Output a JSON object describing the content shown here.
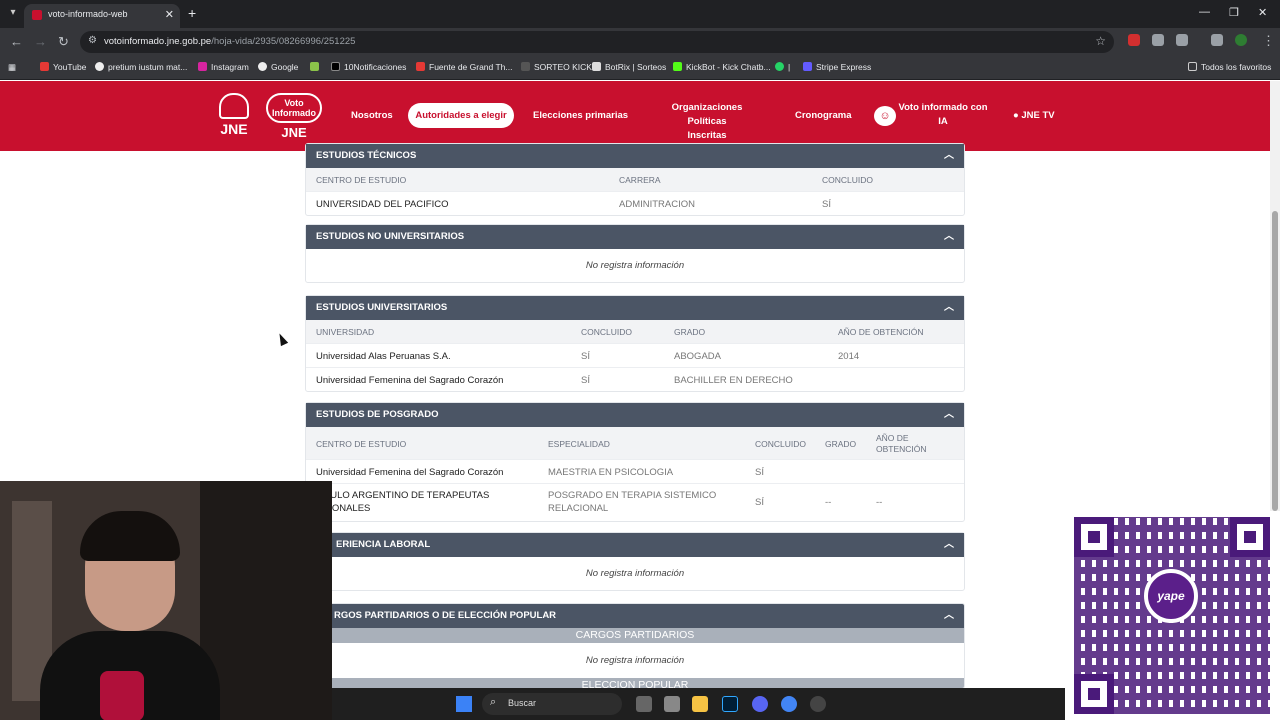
{
  "browser": {
    "tab_title": "voto-informado-web",
    "tab_close": "✕",
    "new_tab": "+",
    "url_host": "votoinformado.jne.gob.pe",
    "url_path": "/hoja-vida/2935/08266996/251225",
    "bookmarks": [
      "YouTube",
      "pretium iustum mat...",
      "Instagram",
      "Google",
      "",
      "10Notificaciones",
      "Fuente de Grand Th...",
      "SORTEO KICK",
      "BotRix | Sorteos",
      "KickBot - Kick Chatb...",
      "|",
      "Stripe Express"
    ],
    "all_bookmarks": "Todos los favoritos"
  },
  "header": {
    "logo_jne": "JNE",
    "logo_voto": "Voto Informado",
    "logo_voto_sub": "JNE",
    "nav": {
      "nosotros": "Nosotros",
      "autoridades": "Autoridades a elegir",
      "elecciones": "Elecciones primarias",
      "organizaciones_1": "Organizaciones Políticas",
      "organizaciones_2": "Inscritas",
      "cronograma": "Cronograma",
      "ia_1": "Voto informado con",
      "ia_2": "IA",
      "jnetv": "● JNE TV"
    }
  },
  "sections": {
    "tecnicos": {
      "title": "ESTUDIOS TÉCNICOS",
      "cols": [
        "CENTRO DE ESTUDIO",
        "CARRERA",
        "CONCLUIDO"
      ],
      "rows": [
        [
          "UNIVERSIDAD DEL PACIFICO",
          "ADMINITRACION",
          "SÍ"
        ]
      ]
    },
    "no_universitarios": {
      "title": "ESTUDIOS NO UNIVERSITARIOS",
      "empty": "No registra información"
    },
    "universitarios": {
      "title": "ESTUDIOS UNIVERSITARIOS",
      "cols": [
        "UNIVERSIDAD",
        "CONCLUIDO",
        "GRADO",
        "AÑO DE OBTENCIÓN"
      ],
      "rows": [
        [
          "Universidad Alas Peruanas S.A.",
          "SÍ",
          "ABOGADA",
          "2014"
        ],
        [
          "Universidad Femenina del Sagrado Corazón",
          "SÍ",
          "BACHILLER EN DERECHO",
          ""
        ]
      ]
    },
    "posgrado": {
      "title": "ESTUDIOS DE POSGRADO",
      "cols": [
        "CENTRO DE ESTUDIO",
        "ESPECIALIDAD",
        "CONCLUIDO",
        "GRADO",
        "AÑO DE",
        "OBTENCIÓN"
      ],
      "rows": [
        [
          "Universidad Femenina del Sagrado Corazón",
          "MAESTRIA EN PSICOLOGIA",
          "SÍ",
          "",
          ""
        ],
        [
          "TITULO ARGENTINO DE TERAPEUTAS",
          "POSGRADO EN TERAPIA SISTEMICO",
          "SÍ",
          "--",
          "--",
          "ACIONALES",
          "RELACIONAL"
        ]
      ]
    },
    "experiencia": {
      "title": "ERIENCIA LABORAL",
      "empty": "No registra información"
    },
    "cargos": {
      "title": "RGOS PARTIDARIOS O DE ELECCIÓN POPULAR",
      "sub1": "CARGOS PARTIDARIOS",
      "empty": "No registra información",
      "sub2": "ELECCION POPULAR"
    }
  },
  "taskbar": {
    "search_label": "Buscar"
  },
  "qr": {
    "logo_text": "yape"
  },
  "colors": {
    "brand_red": "#c8102e",
    "section_header": "#4b5565",
    "qr_purple": "#4a1a7a"
  }
}
